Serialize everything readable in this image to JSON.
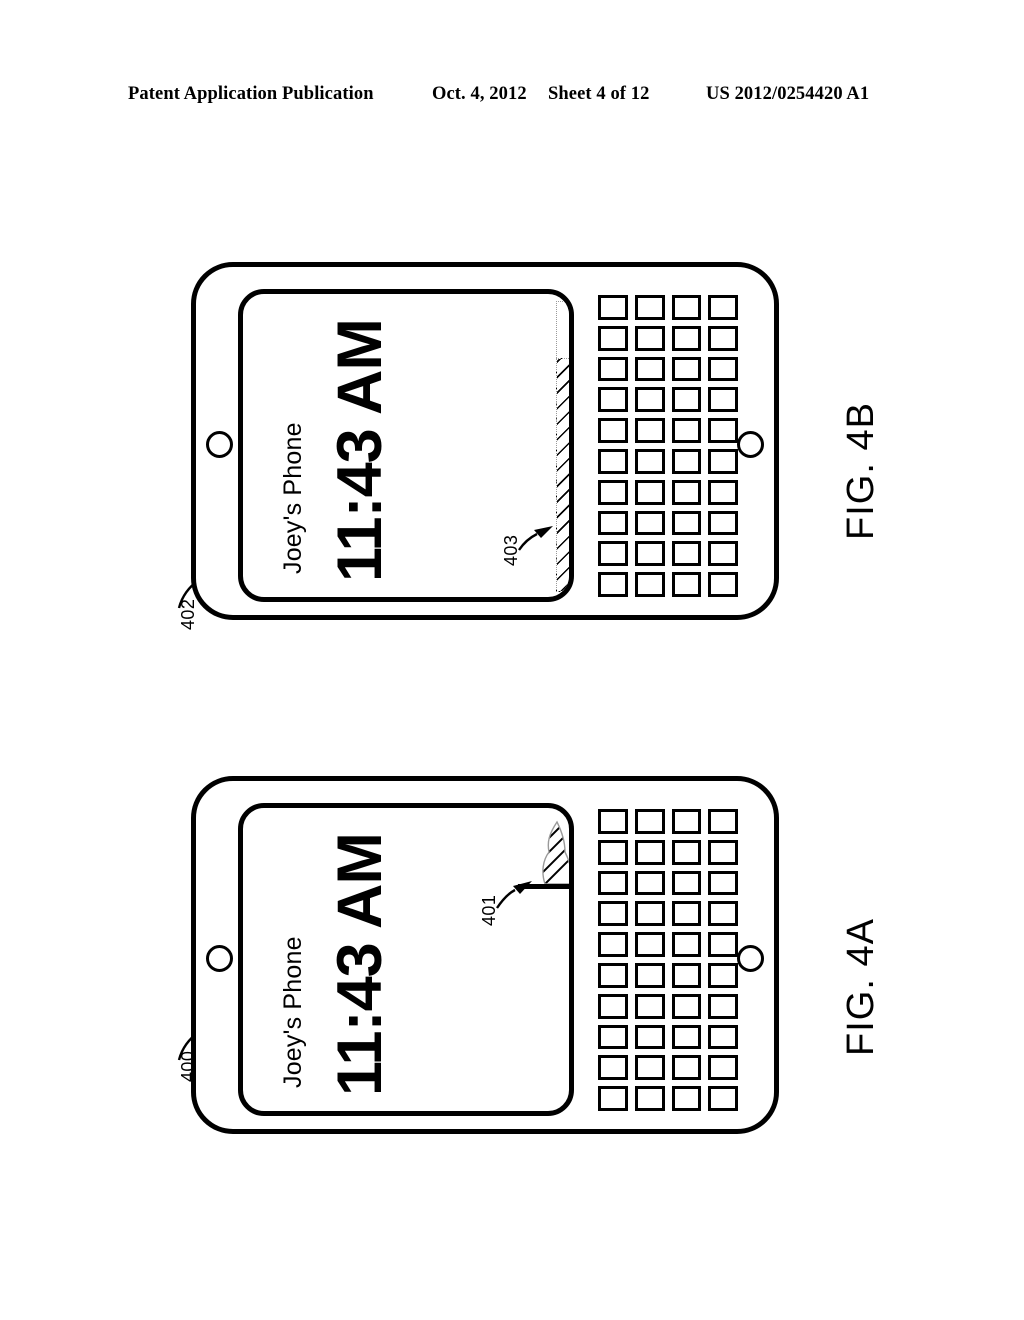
{
  "header": {
    "publication": "Patent Application Publication",
    "date": "Oct. 4, 2012",
    "sheet": "Sheet 4 of 12",
    "doc_number": "US 2012/0254420 A1"
  },
  "figures": [
    {
      "id": "fig-4b",
      "label": "FIG. 4B",
      "device_ref": "402",
      "screen": {
        "device_name": "Joey's Phone",
        "clock": "11:43 AM"
      },
      "indicator": {
        "ref": "403",
        "kind": "hatched-level-bar",
        "fill_percent": 81
      },
      "keyboard": {
        "rows": 10,
        "cols": 4
      }
    },
    {
      "id": "fig-4a",
      "label": "FIG. 4A",
      "device_ref": "400",
      "screen": {
        "device_name": "Joey's Phone",
        "clock": "11:43 AM"
      },
      "indicator": {
        "ref": "401",
        "kind": "hatched-flame-glyph",
        "fill_percent": 8
      },
      "keyboard": {
        "rows": 10,
        "cols": 4
      }
    }
  ],
  "colors": {
    "ink": "#000000",
    "paper": "#ffffff",
    "hatch_outline": "#9a9a9a"
  }
}
